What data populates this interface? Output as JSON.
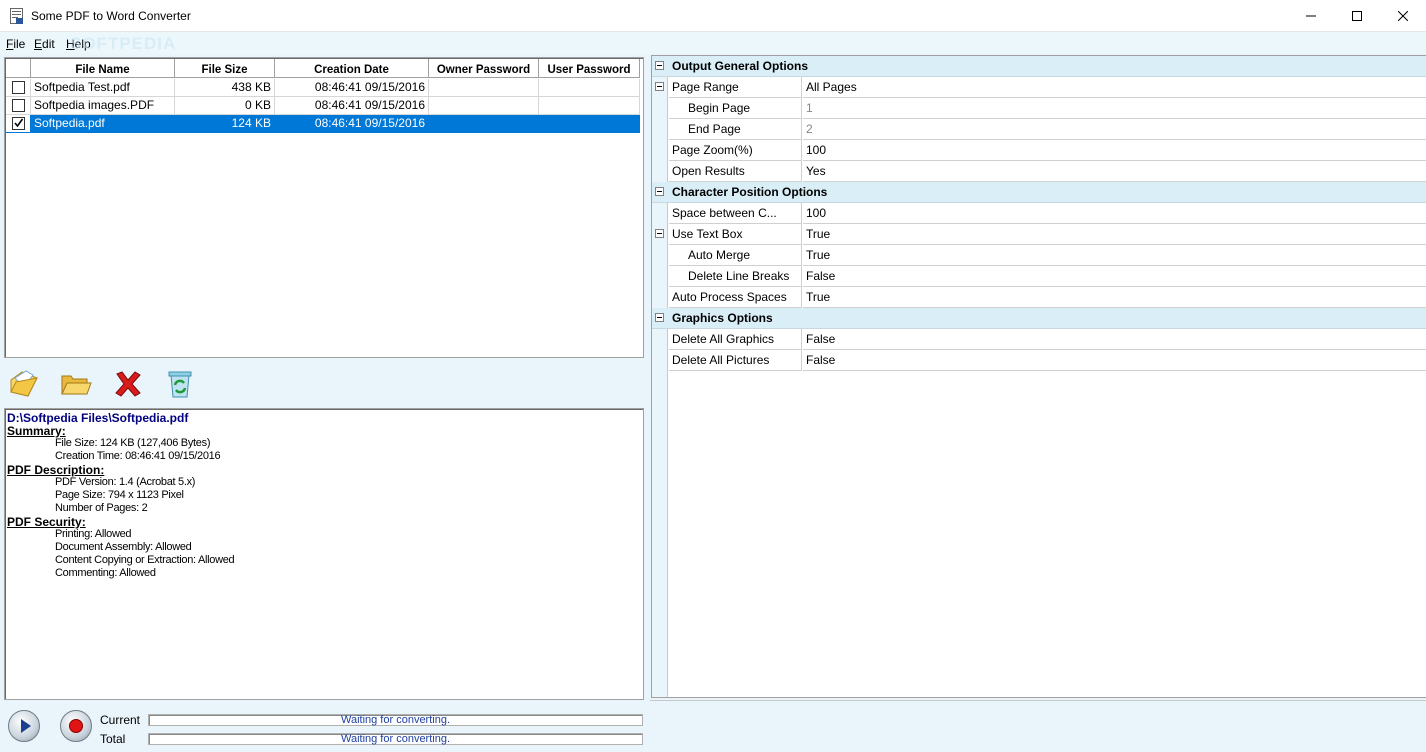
{
  "window": {
    "title": "Some PDF to Word Converter",
    "watermark": "SOFTPEDIA"
  },
  "menu": [
    {
      "label": "File",
      "mnemonic": "F",
      "rest": "ile"
    },
    {
      "label": "Edit",
      "mnemonic": "E",
      "rest": "dit"
    },
    {
      "label": "Help",
      "mnemonic": "H",
      "rest": "elp"
    }
  ],
  "file_list": {
    "columns": [
      "File Name",
      "File Size",
      "Creation Date",
      "Owner Password",
      "User Password"
    ],
    "rows": [
      {
        "checked": false,
        "name": "Softpedia Test.pdf",
        "size": "438 KB",
        "date": "08:46:41 09/15/2016",
        "owner": "",
        "user": ""
      },
      {
        "checked": false,
        "name": "Softpedia images.PDF",
        "size": "0 KB",
        "date": "08:46:41 09/15/2016",
        "owner": "",
        "user": ""
      },
      {
        "checked": true,
        "selected": true,
        "name": "Softpedia.pdf",
        "size": "124 KB",
        "date": "08:46:41 09/15/2016",
        "owner": "",
        "user": ""
      }
    ]
  },
  "toolbar": {
    "icons": [
      "add-file-icon",
      "open-folder-icon",
      "delete-icon",
      "clear-list-icon"
    ]
  },
  "details": {
    "path": "D:\\Softpedia Files\\Softpedia.pdf",
    "sections": [
      {
        "title": "Summary:",
        "lines": [
          "File Size: 124 KB (127,406 Bytes)",
          "Creation Time: 08:46:41 09/15/2016"
        ]
      },
      {
        "title": "PDF Description:",
        "lines": [
          "PDF Version: 1.4 (Acrobat 5.x)",
          "Page Size: 794 x 1123 Pixel",
          "Number of Pages: 2"
        ]
      },
      {
        "title": "PDF Security:",
        "lines": [
          "Printing: Allowed",
          "Document Assembly: Allowed",
          "Content Copying or Extraction: Allowed",
          "Commenting: Allowed"
        ]
      }
    ]
  },
  "progress": {
    "current_label": "Current",
    "current_text": "Waiting for converting.",
    "total_label": "Total",
    "total_text": "Waiting for converting."
  },
  "properties": {
    "categories": [
      {
        "title": "Output General Options",
        "items": [
          {
            "name": "Page Range",
            "value": "All Pages",
            "expandable": true
          },
          {
            "name": "Begin Page",
            "value": "1",
            "indent": true,
            "dim": true
          },
          {
            "name": "End Page",
            "value": "2",
            "indent": true,
            "dim": true
          },
          {
            "name": "Page Zoom(%)",
            "value": "100"
          },
          {
            "name": "Open Results",
            "value": "Yes"
          }
        ]
      },
      {
        "title": "Character Position Options",
        "items": [
          {
            "name": "Space between C...",
            "value": "100"
          },
          {
            "name": "Use Text Box",
            "value": "True",
            "expandable": true
          },
          {
            "name": "Auto Merge",
            "value": "True",
            "indent": true
          },
          {
            "name": "Delete Line Breaks",
            "value": "False",
            "indent": true
          },
          {
            "name": "Auto Process Spaces",
            "value": "True"
          }
        ]
      },
      {
        "title": "Graphics Options",
        "items": [
          {
            "name": "Delete All Graphics",
            "value": "False"
          },
          {
            "name": "Delete All Pictures",
            "value": "False"
          }
        ]
      }
    ]
  },
  "colors": {
    "selection": "#0078d7",
    "panel_bg": "#eaf5fb",
    "category_bg": "#daeef8",
    "progress_text": "#1f3fa0",
    "path_text": "#000080"
  }
}
